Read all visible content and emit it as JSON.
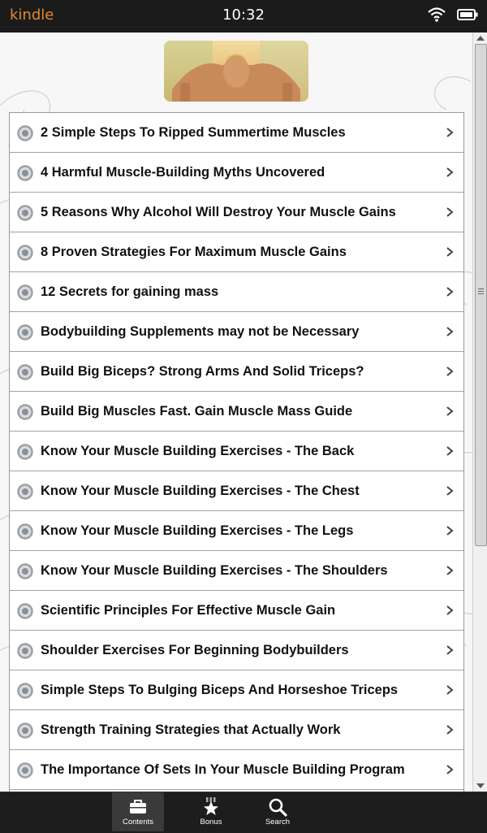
{
  "statusbar": {
    "brand": "kindle",
    "time": "10:32",
    "wifi_icon": "wifi-icon",
    "battery_icon": "battery-icon"
  },
  "banner": {
    "image": "push-up-man-photo"
  },
  "list": {
    "items": [
      {
        "label": "2 Simple Steps To Ripped Summertime Muscles"
      },
      {
        "label": "4 Harmful Muscle-Building Myths Uncovered"
      },
      {
        "label": "5 Reasons Why Alcohol Will Destroy Your Muscle Gains"
      },
      {
        "label": "8 Proven Strategies For Maximum Muscle Gains"
      },
      {
        "label": "12 Secrets for gaining mass"
      },
      {
        "label": "Bodybuilding Supplements may not be Necessary"
      },
      {
        "label": "Build Big Biceps? Strong Arms And Solid Triceps?"
      },
      {
        "label": "Build Big Muscles Fast. Gain Muscle Mass Guide"
      },
      {
        "label": "Know Your Muscle Building Exercises - The Back"
      },
      {
        "label": "Know Your Muscle Building Exercises - The Chest"
      },
      {
        "label": "Know Your Muscle Building Exercises - The Legs"
      },
      {
        "label": "Know Your Muscle Building Exercises - The Shoulders"
      },
      {
        "label": "Scientific Principles For Effective Muscle Gain"
      },
      {
        "label": "Shoulder Exercises For Beginning Bodybuilders"
      },
      {
        "label": "Simple Steps To Bulging Biceps And Horseshoe Triceps"
      },
      {
        "label": "Strength Training Strategies that Actually Work"
      },
      {
        "label": "The Importance Of Sets In Your Muscle Building Program"
      }
    ]
  },
  "tabbar": {
    "tabs": [
      {
        "label": "Contents",
        "icon": "briefcase-icon",
        "active": true
      },
      {
        "label": "Bonus",
        "icon": "star-icon",
        "active": false
      },
      {
        "label": "Search",
        "icon": "search-icon",
        "active": false
      }
    ]
  },
  "colors": {
    "brand": "#e08a2a",
    "statusbar_bg": "#1b1b1b",
    "tabbar_bg": "#1d1d1d",
    "row_border": "#a3a3a3"
  }
}
